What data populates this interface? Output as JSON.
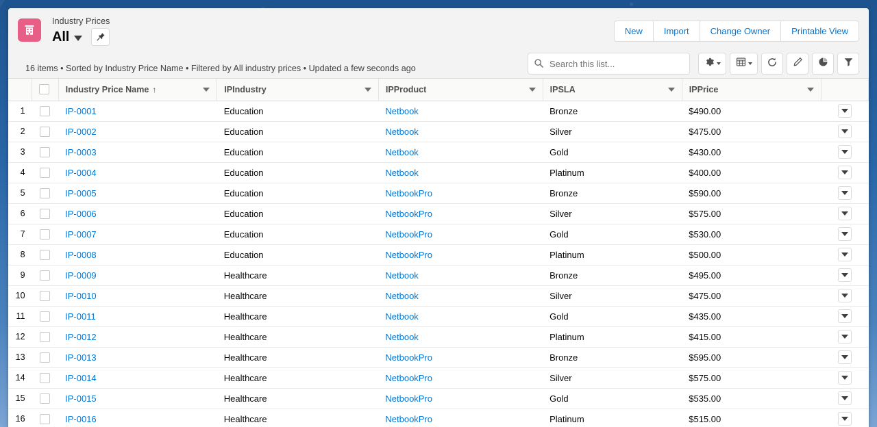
{
  "header": {
    "object_icon": "building-icon",
    "eyebrow": "Industry Prices",
    "list_view_name": "All",
    "pin_icon": "pin-icon",
    "meta": "16 items • Sorted by Industry Price Name • Filtered by All industry prices • Updated a few seconds ago",
    "accent_color": "#e75e87",
    "link_color": "#0176d3"
  },
  "actions": {
    "new_label": "New",
    "import_label": "Import",
    "change_owner_label": "Change Owner",
    "printable_view_label": "Printable View"
  },
  "search": {
    "placeholder": "Search this list...",
    "value": "",
    "icon": "search-icon"
  },
  "toolbar": {
    "list_settings_icon": "gear-icon",
    "display_as_icon": "table-grid-icon",
    "refresh_icon": "refresh-icon",
    "edit_icon": "pencil-icon",
    "charts_icon": "pie-chart-icon",
    "filters_icon": "funnel-filter-icon"
  },
  "table": {
    "select_all_label": "",
    "columns": [
      {
        "label": "Industry Price Name",
        "sorted": true,
        "sort_dir": "↑"
      },
      {
        "label": "IPIndustry",
        "sorted": false,
        "sort_dir": ""
      },
      {
        "label": "IPProduct",
        "sorted": false,
        "sort_dir": ""
      },
      {
        "label": "IPSLA",
        "sorted": false,
        "sort_dir": ""
      },
      {
        "label": "IPPrice",
        "sorted": false,
        "sort_dir": ""
      }
    ],
    "rows": [
      {
        "n": "1",
        "name": "IP-0001",
        "industry": "Education",
        "product": "Netbook",
        "sla": "Bronze",
        "price": "$490.00"
      },
      {
        "n": "2",
        "name": "IP-0002",
        "industry": "Education",
        "product": "Netbook",
        "sla": "Silver",
        "price": "$475.00"
      },
      {
        "n": "3",
        "name": "IP-0003",
        "industry": "Education",
        "product": "Netbook",
        "sla": "Gold",
        "price": "$430.00"
      },
      {
        "n": "4",
        "name": "IP-0004",
        "industry": "Education",
        "product": "Netbook",
        "sla": "Platinum",
        "price": "$400.00"
      },
      {
        "n": "5",
        "name": "IP-0005",
        "industry": "Education",
        "product": "NetbookPro",
        "sla": "Bronze",
        "price": "$590.00"
      },
      {
        "n": "6",
        "name": "IP-0006",
        "industry": "Education",
        "product": "NetbookPro",
        "sla": "Silver",
        "price": "$575.00"
      },
      {
        "n": "7",
        "name": "IP-0007",
        "industry": "Education",
        "product": "NetbookPro",
        "sla": "Gold",
        "price": "$530.00"
      },
      {
        "n": "8",
        "name": "IP-0008",
        "industry": "Education",
        "product": "NetbookPro",
        "sla": "Platinum",
        "price": "$500.00"
      },
      {
        "n": "9",
        "name": "IP-0009",
        "industry": "Healthcare",
        "product": "Netbook",
        "sla": "Bronze",
        "price": "$495.00"
      },
      {
        "n": "10",
        "name": "IP-0010",
        "industry": "Healthcare",
        "product": "Netbook",
        "sla": "Silver",
        "price": "$475.00"
      },
      {
        "n": "11",
        "name": "IP-0011",
        "industry": "Healthcare",
        "product": "Netbook",
        "sla": "Gold",
        "price": "$435.00"
      },
      {
        "n": "12",
        "name": "IP-0012",
        "industry": "Healthcare",
        "product": "Netbook",
        "sla": "Platinum",
        "price": "$415.00"
      },
      {
        "n": "13",
        "name": "IP-0013",
        "industry": "Healthcare",
        "product": "NetbookPro",
        "sla": "Bronze",
        "price": "$595.00"
      },
      {
        "n": "14",
        "name": "IP-0014",
        "industry": "Healthcare",
        "product": "NetbookPro",
        "sla": "Silver",
        "price": "$575.00"
      },
      {
        "n": "15",
        "name": "IP-0015",
        "industry": "Healthcare",
        "product": "NetbookPro",
        "sla": "Gold",
        "price": "$535.00"
      },
      {
        "n": "16",
        "name": "IP-0016",
        "industry": "Healthcare",
        "product": "NetbookPro",
        "sla": "Platinum",
        "price": "$515.00"
      }
    ]
  }
}
